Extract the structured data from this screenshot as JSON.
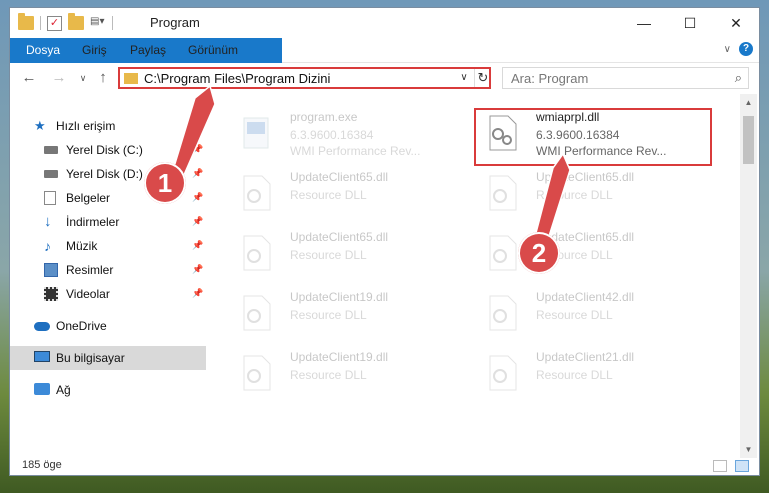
{
  "window": {
    "title": "Program"
  },
  "window_controls": {
    "minimize": "—",
    "maximize": "☐",
    "close": "✕"
  },
  "ribbon": {
    "tabs": [
      "Dosya",
      "Giriş",
      "Paylaş",
      "Görünüm"
    ],
    "collapse": "∨",
    "help": "?"
  },
  "nav": {
    "back": "←",
    "forward": "→",
    "recent": "∨",
    "up": "↑"
  },
  "address": {
    "path": "C:\\Program Files\\Program Dizini",
    "dropdown": "∨",
    "refresh": "↻"
  },
  "search": {
    "placeholder": "Ara: Program",
    "icon": "⌕"
  },
  "sidebar": {
    "items": [
      {
        "label": "Hızlı erişim",
        "icon": "star-icon"
      },
      {
        "label": "Yerel Disk (C:)",
        "icon": "drive-icon",
        "pinned": true
      },
      {
        "label": "Yerel Disk (D:)",
        "icon": "drive-icon",
        "pinned": true
      },
      {
        "label": "Belgeler",
        "icon": "documents-icon",
        "pinned": true
      },
      {
        "label": "İndirmeler",
        "icon": "download-icon",
        "pinned": true
      },
      {
        "label": "Müzik",
        "icon": "music-icon",
        "pinned": true
      },
      {
        "label": "Resimler",
        "icon": "pictures-icon",
        "pinned": true
      },
      {
        "label": "Videolar",
        "icon": "video-icon",
        "pinned": true
      },
      {
        "label": "OneDrive",
        "icon": "cloud-icon"
      },
      {
        "label": "Bu bilgisayar",
        "icon": "computer-icon",
        "selected": true
      },
      {
        "label": "Ağ",
        "icon": "network-icon"
      }
    ]
  },
  "files": [
    {
      "name": "program.exe",
      "line2": "6.3.9600.16384",
      "line3": "WMI Performance Rev...",
      "faded": true
    },
    {
      "name": "wmiaprpl.dll",
      "line2": "6.3.9600.16384",
      "line3": "WMI Performance Rev...",
      "faded": false
    },
    {
      "name": "UpdateClient65.dll",
      "line2": "Resource DLL",
      "faded": true
    },
    {
      "name": "UpdateClient65.dll",
      "line2": "Resource DLL",
      "faded": true
    },
    {
      "name": "UpdateClient65.dll",
      "line2": "Resource DLL",
      "faded": true
    },
    {
      "name": "UpdateClient65.dll",
      "line2": "Resource DLL",
      "faded": true
    },
    {
      "name": "UpdateClient19.dll",
      "line2": "Resource DLL",
      "faded": true
    },
    {
      "name": "UpdateClient42.dll",
      "line2": "Resource DLL",
      "faded": true
    },
    {
      "name": "UpdateClient19.dll",
      "line2": "Resource DLL",
      "faded": true
    },
    {
      "name": "UpdateClient21.dll",
      "line2": "Resource DLL",
      "faded": true
    }
  ],
  "annotations": {
    "badge1": "1",
    "badge2": "2"
  },
  "status": {
    "count": "185 öge"
  },
  "scrollbar": {
    "up": "▲",
    "down": "▼"
  },
  "colors": {
    "accent": "#1979ca",
    "highlight": "#d93b3b"
  }
}
